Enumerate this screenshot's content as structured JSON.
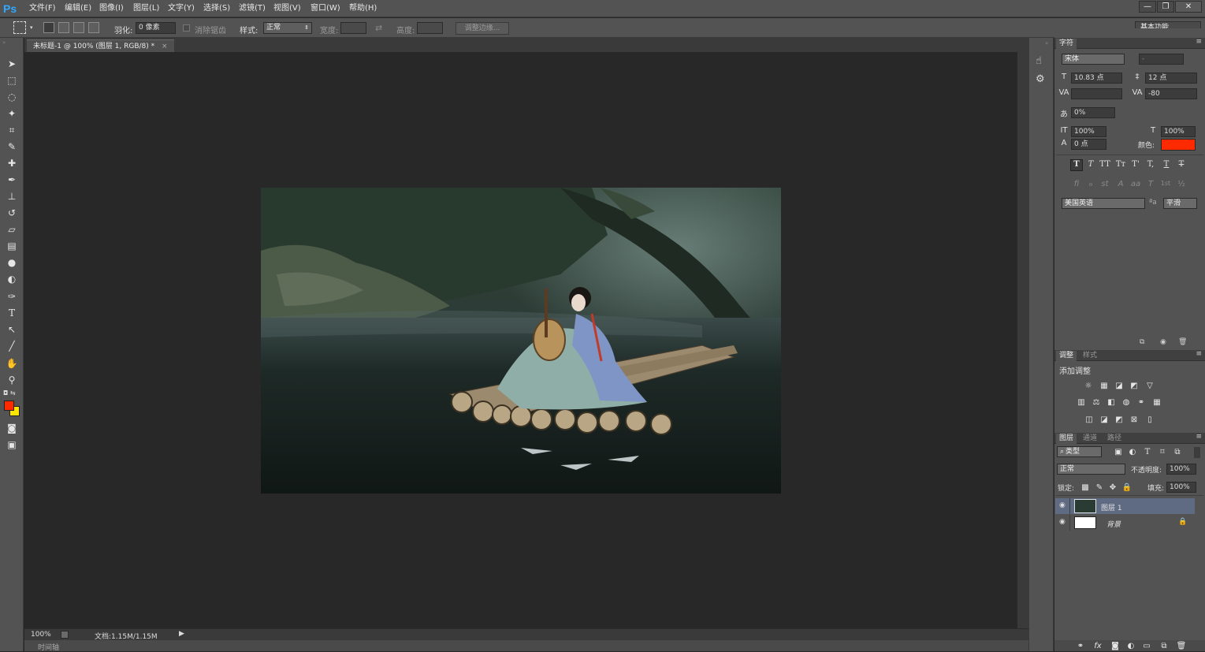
{
  "app": {
    "logo": "Ps"
  },
  "menu": [
    "文件(F)",
    "编辑(E)",
    "图像(I)",
    "图层(L)",
    "文字(Y)",
    "选择(S)",
    "滤镜(T)",
    "视图(V)",
    "窗口(W)",
    "帮助(H)"
  ],
  "window_controls": {
    "minimize": "—",
    "restore": "❐",
    "close": "✕"
  },
  "workspace": {
    "label": "基本功能"
  },
  "options": {
    "feather_label": "羽化:",
    "feather_value": "0 像素",
    "antialias_label": "消除锯齿",
    "style_label": "样式:",
    "style_value": "正常",
    "width_label": "宽度:",
    "height_label": "高度:",
    "refine_edge": "调整边缘..."
  },
  "document": {
    "tab_title": "未标题-1 @ 100% (图层 1, RGB/8) *",
    "tab_close": "×",
    "zoom": "100%",
    "doc_size": "文档:1.15M/1.15M",
    "timeline": "时间轴"
  },
  "character": {
    "tab": "字符",
    "font_family": "宋体",
    "font_style": "-",
    "font_size": "10.83 点",
    "leading": "12 点",
    "kerning": "",
    "tracking": "-80",
    "scale_percent": "0%",
    "vertical_scale": "100%",
    "horizontal_scale": "100%",
    "baseline_shift": "0 点",
    "color_label": "颜色:",
    "color": "#ff2a00",
    "type_styles": [
      "T",
      "T",
      "TT",
      "Tт",
      "T'",
      "T,",
      "T",
      "T"
    ],
    "opentype": [
      "fi",
      "ℴ",
      "st",
      "A",
      "aa",
      "T",
      "1st",
      "½"
    ],
    "language": "美国英语",
    "aa_icon": "ªa",
    "antialias": "平滑"
  },
  "adjustments": {
    "tabs": [
      "调整",
      "样式"
    ],
    "add_label": "添加调整"
  },
  "layers": {
    "tabs": [
      "图层",
      "通道",
      "路径"
    ],
    "filter": "类型",
    "blend_mode": "正常",
    "opacity_label": "不透明度:",
    "opacity": "100%",
    "lock_label": "锁定:",
    "fill_label": "填充:",
    "fill": "100%",
    "items": [
      {
        "name": "图层 1",
        "selected": true
      },
      {
        "name": "背景",
        "locked": true
      }
    ]
  },
  "colors": {
    "foreground": "#ff2a00",
    "background": "#ffe600",
    "accent": "#31a8ff"
  }
}
